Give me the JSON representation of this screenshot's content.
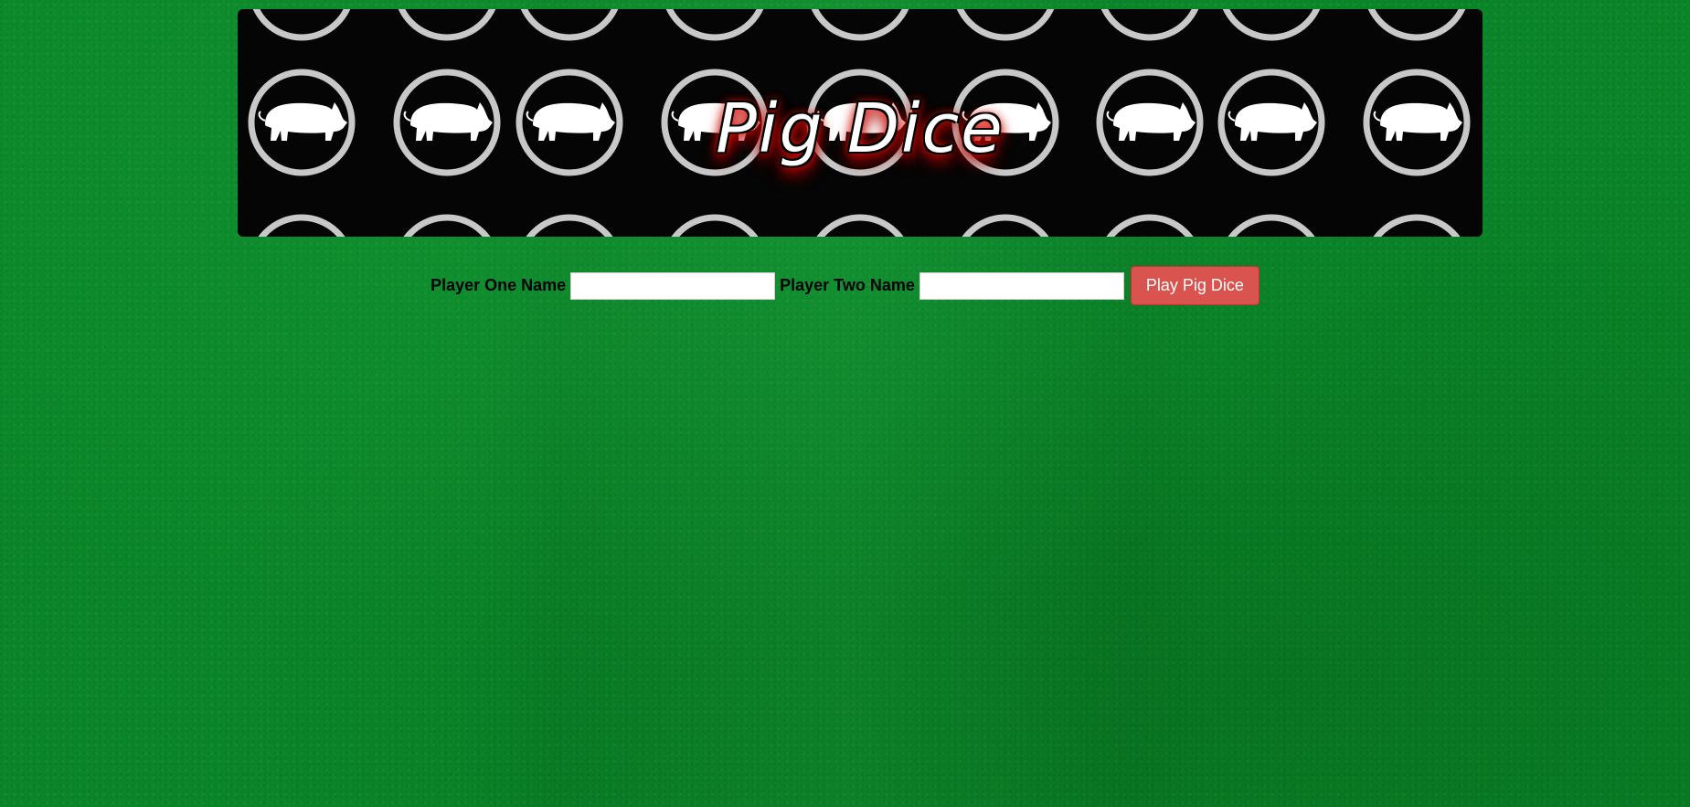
{
  "banner": {
    "title": "Pig Dice",
    "pattern_icon": "pig-icon"
  },
  "form": {
    "player_one_label": "Player One Name",
    "player_one_value": "",
    "player_two_label": "Player Two Name",
    "player_two_value": "",
    "play_button_label": "Play Pig Dice"
  },
  "colors": {
    "felt_green": "#0a8a2a",
    "banner_bg": "#050505",
    "button_red": "#d9534f"
  }
}
